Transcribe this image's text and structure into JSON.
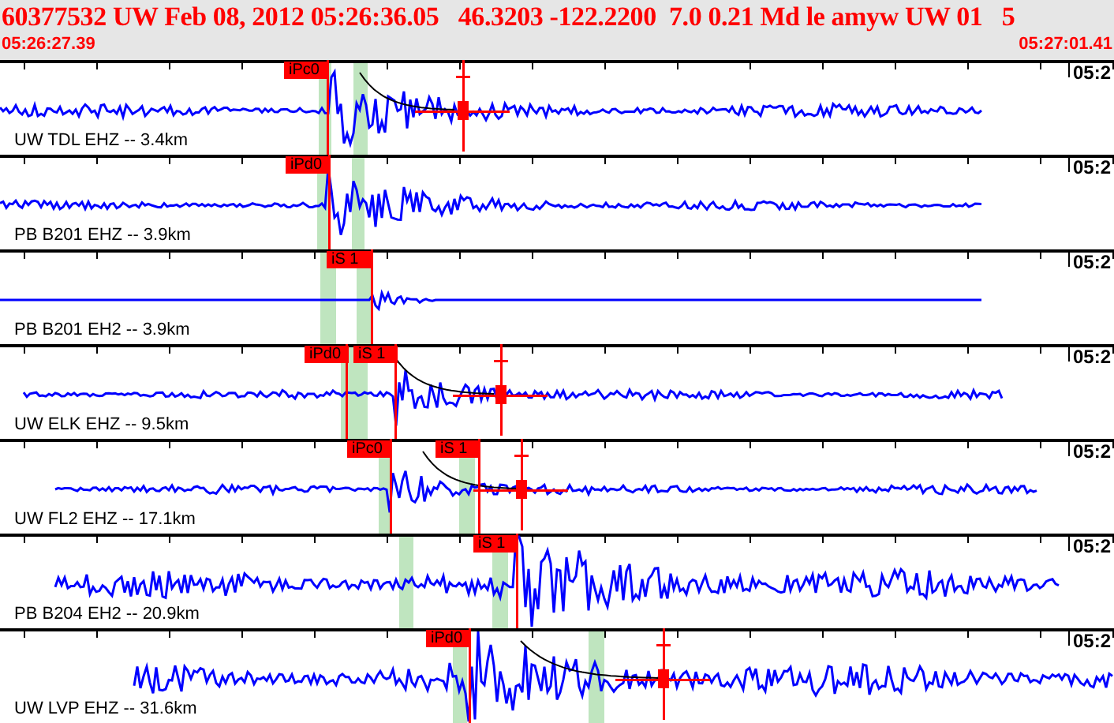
{
  "header": {
    "title": "60377532 UW Feb 08, 2012 05:26:36.05   46.3203 -122.2200  7.0 0.21 Md le amyw UW 01   5",
    "start_time": "05:26:27.39",
    "end_time": "05:27:01.41"
  },
  "traces": [
    {
      "station": "UW TDL EHZ -- 3.4km",
      "time_label": "05:2",
      "picks": [
        {
          "label": "iPc0"
        }
      ]
    },
    {
      "station": "PB B201 EHZ -- 3.9km",
      "time_label": "05:2",
      "picks": [
        {
          "label": "iPd0"
        }
      ]
    },
    {
      "station": "PB B201 EH2 -- 3.9km",
      "time_label": "05:2",
      "picks": [
        {
          "label": "iS 1"
        }
      ]
    },
    {
      "station": "UW ELK EHZ -- 9.5km",
      "time_label": "05:2",
      "picks": [
        {
          "label": "iPd0"
        },
        {
          "label": "iS 1"
        }
      ]
    },
    {
      "station": "UW FL2 EHZ -- 17.1km",
      "time_label": "05:2",
      "picks": [
        {
          "label": "iPc0"
        },
        {
          "label": "iS 1"
        }
      ]
    },
    {
      "station": "PB B204 EH2 -- 20.9km",
      "time_label": "05:2",
      "picks": [
        {
          "label": "iS 1"
        }
      ]
    },
    {
      "station": "UW LVP EHZ -- 31.6km",
      "time_label": "05:2",
      "picks": [
        {
          "label": "iPd0"
        }
      ]
    }
  ]
}
